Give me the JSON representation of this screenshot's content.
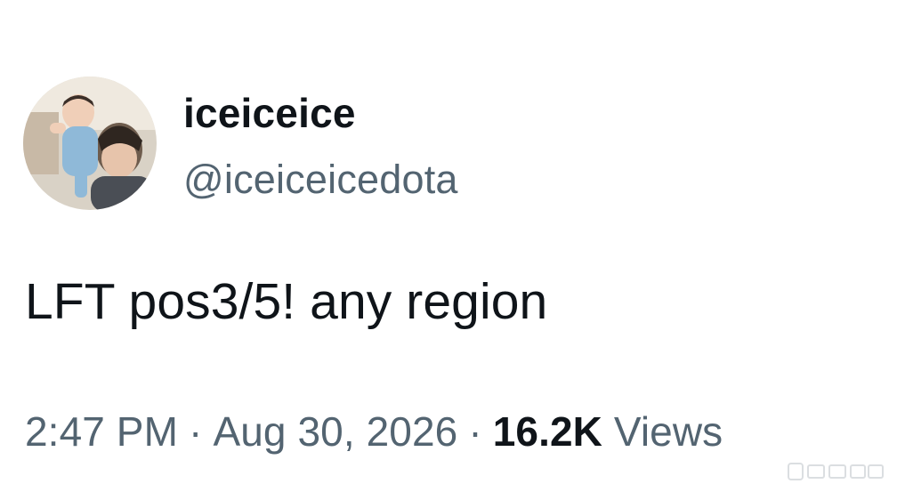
{
  "tweet": {
    "display_name": "iceiceice",
    "handle": "@iceiceicedota",
    "text": "LFT pos3/5! any region",
    "time": "2:47 PM",
    "separator": "·",
    "date": "Aug 30, 2026",
    "views_count": "16.2K",
    "views_label": "Views"
  },
  "icons": {
    "avatar": "profile-photo",
    "watermark": "weibo-watermark"
  },
  "colors": {
    "text_primary": "#0f1419",
    "text_secondary": "#536471",
    "background": "#ffffff"
  }
}
